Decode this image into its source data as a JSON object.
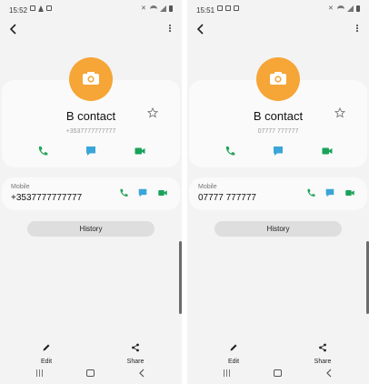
{
  "screens": [
    {
      "status_time": "15:52",
      "contact_name": "B contact",
      "contact_number": "+3537777777777",
      "mobile_label": "Mobile",
      "mobile_number": "+3537777777777",
      "history_label": "History",
      "edit_label": "Edit",
      "share_label": "Share"
    },
    {
      "status_time": "15:51",
      "contact_name": "B contact",
      "contact_number": "07777 777777",
      "mobile_label": "Mobile",
      "mobile_number": "07777 777777",
      "history_label": "History",
      "edit_label": "Edit",
      "share_label": "Share"
    }
  ],
  "colors": {
    "avatar": "#f6a537",
    "call": "#25a35a",
    "message": "#3aa6d8",
    "video": "#19a35a"
  },
  "icons": {
    "avatar": "camera-icon",
    "favorite": "star-icon",
    "call": "phone-icon",
    "message": "message-icon",
    "video": "video-icon",
    "edit": "pencil-icon",
    "share": "share-icon"
  }
}
